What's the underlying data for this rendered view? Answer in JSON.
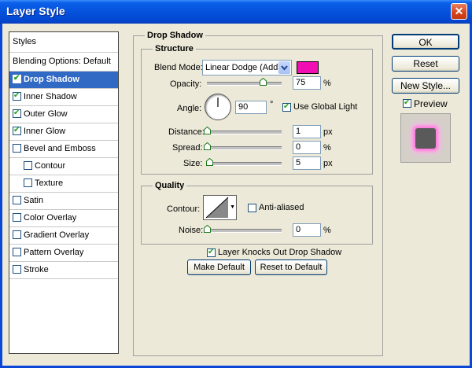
{
  "window": {
    "title": "Layer Style",
    "close_label": "✕"
  },
  "styles_list": {
    "header": "Styles",
    "blending": "Blending Options: Default",
    "items": [
      {
        "label": "Drop Shadow",
        "checked": true,
        "selected": true,
        "indent": false
      },
      {
        "label": "Inner Shadow",
        "checked": true,
        "indent": false
      },
      {
        "label": "Outer Glow",
        "checked": true,
        "indent": false
      },
      {
        "label": "Inner Glow",
        "checked": true,
        "indent": false
      },
      {
        "label": "Bevel and Emboss",
        "checked": false,
        "indent": false
      },
      {
        "label": "Contour",
        "checked": false,
        "indent": true
      },
      {
        "label": "Texture",
        "checked": false,
        "indent": true
      },
      {
        "label": "Satin",
        "checked": false,
        "indent": false
      },
      {
        "label": "Color Overlay",
        "checked": false,
        "indent": false
      },
      {
        "label": "Gradient Overlay",
        "checked": false,
        "indent": false
      },
      {
        "label": "Pattern Overlay",
        "checked": false,
        "indent": false
      },
      {
        "label": "Stroke",
        "checked": false,
        "indent": false
      }
    ]
  },
  "drop_shadow": {
    "title": "Drop Shadow",
    "structure": {
      "title": "Structure",
      "blend_mode_label": "Blend Mode:",
      "blend_mode_value": "Linear Dodge (Add)",
      "color": "#f10fb3",
      "opacity_label": "Opacity:",
      "opacity_value": "75",
      "opacity_fraction": 0.75,
      "opacity_unit": "%",
      "angle_label": "Angle:",
      "angle_value": "90",
      "angle_unit": "°",
      "global_light_label": "Use Global Light",
      "global_light_checked": true,
      "distance_label": "Distance:",
      "distance_value": "1",
      "distance_unit": "px",
      "distance_fraction": 0.0,
      "spread_label": "Spread:",
      "spread_value": "0",
      "spread_unit": "%",
      "spread_fraction": 0.0,
      "size_label": "Size:",
      "size_value": "5",
      "size_unit": "px",
      "size_fraction": 0.03
    },
    "quality": {
      "title": "Quality",
      "contour_label": "Contour:",
      "anti_aliased_label": "Anti-aliased",
      "anti_aliased_checked": false,
      "noise_label": "Noise:",
      "noise_value": "0",
      "noise_unit": "%",
      "noise_fraction": 0.0
    },
    "knocks_out_label": "Layer Knocks Out Drop Shadow",
    "knocks_out_checked": true,
    "make_default_label": "Make Default",
    "reset_default_label": "Reset to Default"
  },
  "buttons": {
    "ok": "OK",
    "reset": "Reset",
    "new_style": "New Style...",
    "preview_label": "Preview",
    "preview_checked": true
  }
}
